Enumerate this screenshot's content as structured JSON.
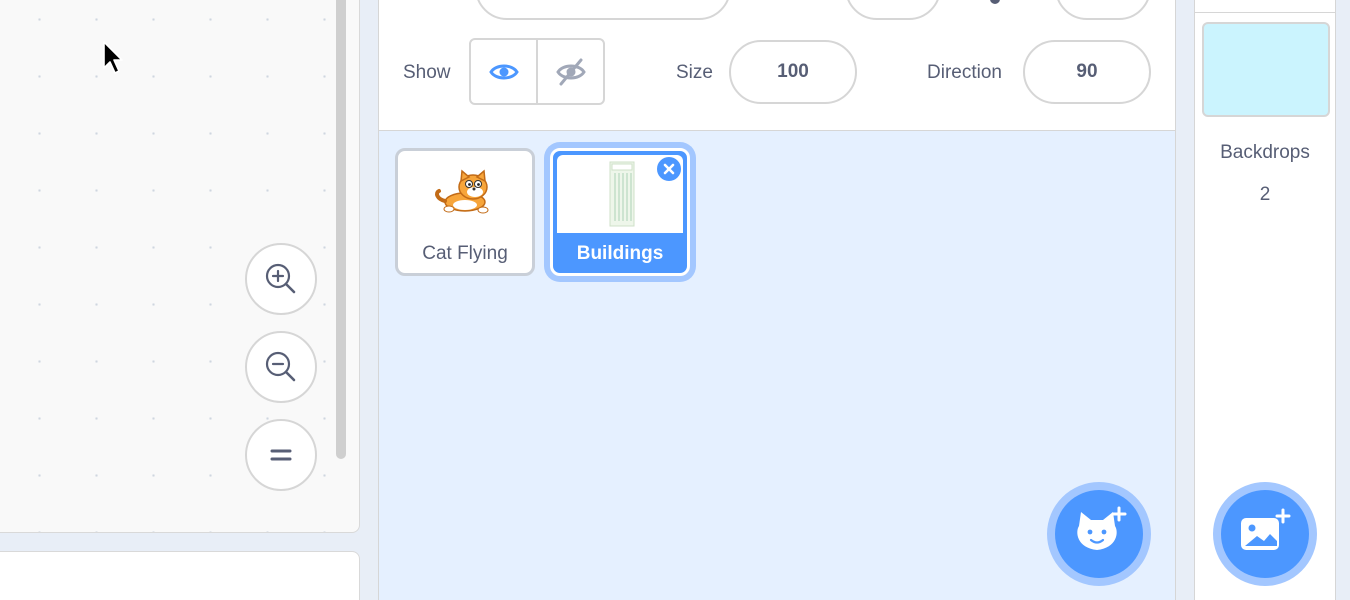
{
  "sprite_info": {
    "show_label": "Show",
    "size_label": "Size",
    "size_value": "100",
    "direction_label": "Direction",
    "direction_value": "90"
  },
  "sprites": [
    {
      "name": "Cat Flying",
      "selected": false
    },
    {
      "name": "Buildings",
      "selected": true
    }
  ],
  "stage": {
    "backdrops_label": "Backdrops",
    "backdrops_count": "2"
  },
  "colors": {
    "accent": "#4c97ff",
    "accent_light": "#a3c7ff",
    "pane_bg": "#e5f0ff",
    "backdrop_thumb": "#cbf4fe",
    "text": "#575e75"
  },
  "icons": {
    "zoom_in": "zoom-in-icon",
    "zoom_out": "zoom-out-icon",
    "zoom_reset": "equals-icon",
    "show": "eye-icon",
    "hide": "eye-slash-icon",
    "delete": "close-icon",
    "add_sprite": "cat-plus-icon",
    "add_backdrop": "image-plus-icon"
  }
}
